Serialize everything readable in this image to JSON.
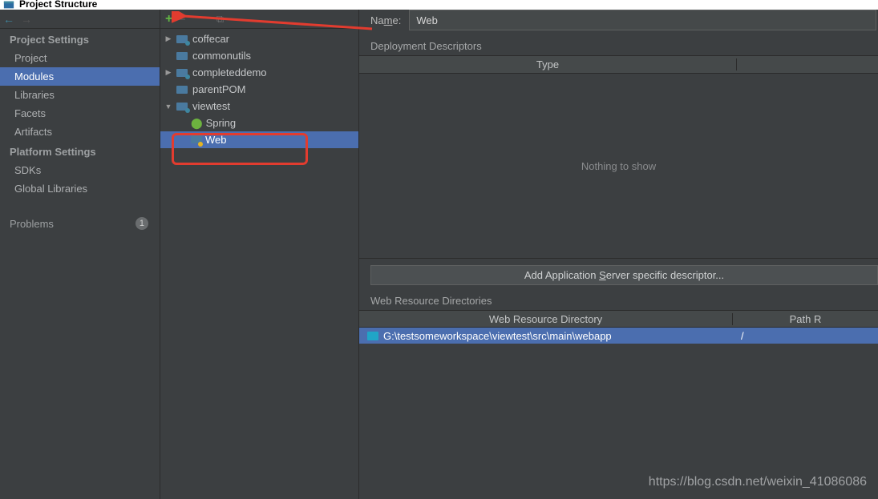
{
  "title": "Project Structure",
  "sidebar": {
    "projectSettingsHeader": "Project Settings",
    "platformSettingsHeader": "Platform Settings",
    "items": {
      "project": "Project",
      "modules": "Modules",
      "libraries": "Libraries",
      "facets": "Facets",
      "artifacts": "Artifacts",
      "sdks": "SDKs",
      "globalLibraries": "Global Libraries",
      "problems": "Problems"
    },
    "problemsCount": "1"
  },
  "tree": {
    "coffecar": "coffecar",
    "commonutils": "commonutils",
    "completeddemo": "completeddemo",
    "parentPOM": "parentPOM",
    "viewtest": "viewtest",
    "spring": "Spring",
    "web": "Web"
  },
  "detail": {
    "nameLabelPrefix": "Na",
    "nameLabelUnderline": "m",
    "nameLabelSuffix": "e:",
    "nameValue": "Web",
    "deployDescriptorsLabel": "Deployment Descriptors",
    "typeHeader": "Type",
    "nothingToShow": "Nothing to show",
    "addDescriptorBtnPrefix": "Add Application ",
    "addDescriptorBtnUnderline": "S",
    "addDescriptorBtnSuffix": "erver specific descriptor...",
    "webResDirLabel": "Web Resource Directories",
    "webResDirHeader": "Web Resource Directory",
    "pathHeader": "Path R",
    "webResPath": "G:\\testsomeworkspace\\viewtest\\src\\main\\webapp",
    "pathRelative": "/"
  },
  "watermark": "https://blog.csdn.net/weixin_41086086"
}
